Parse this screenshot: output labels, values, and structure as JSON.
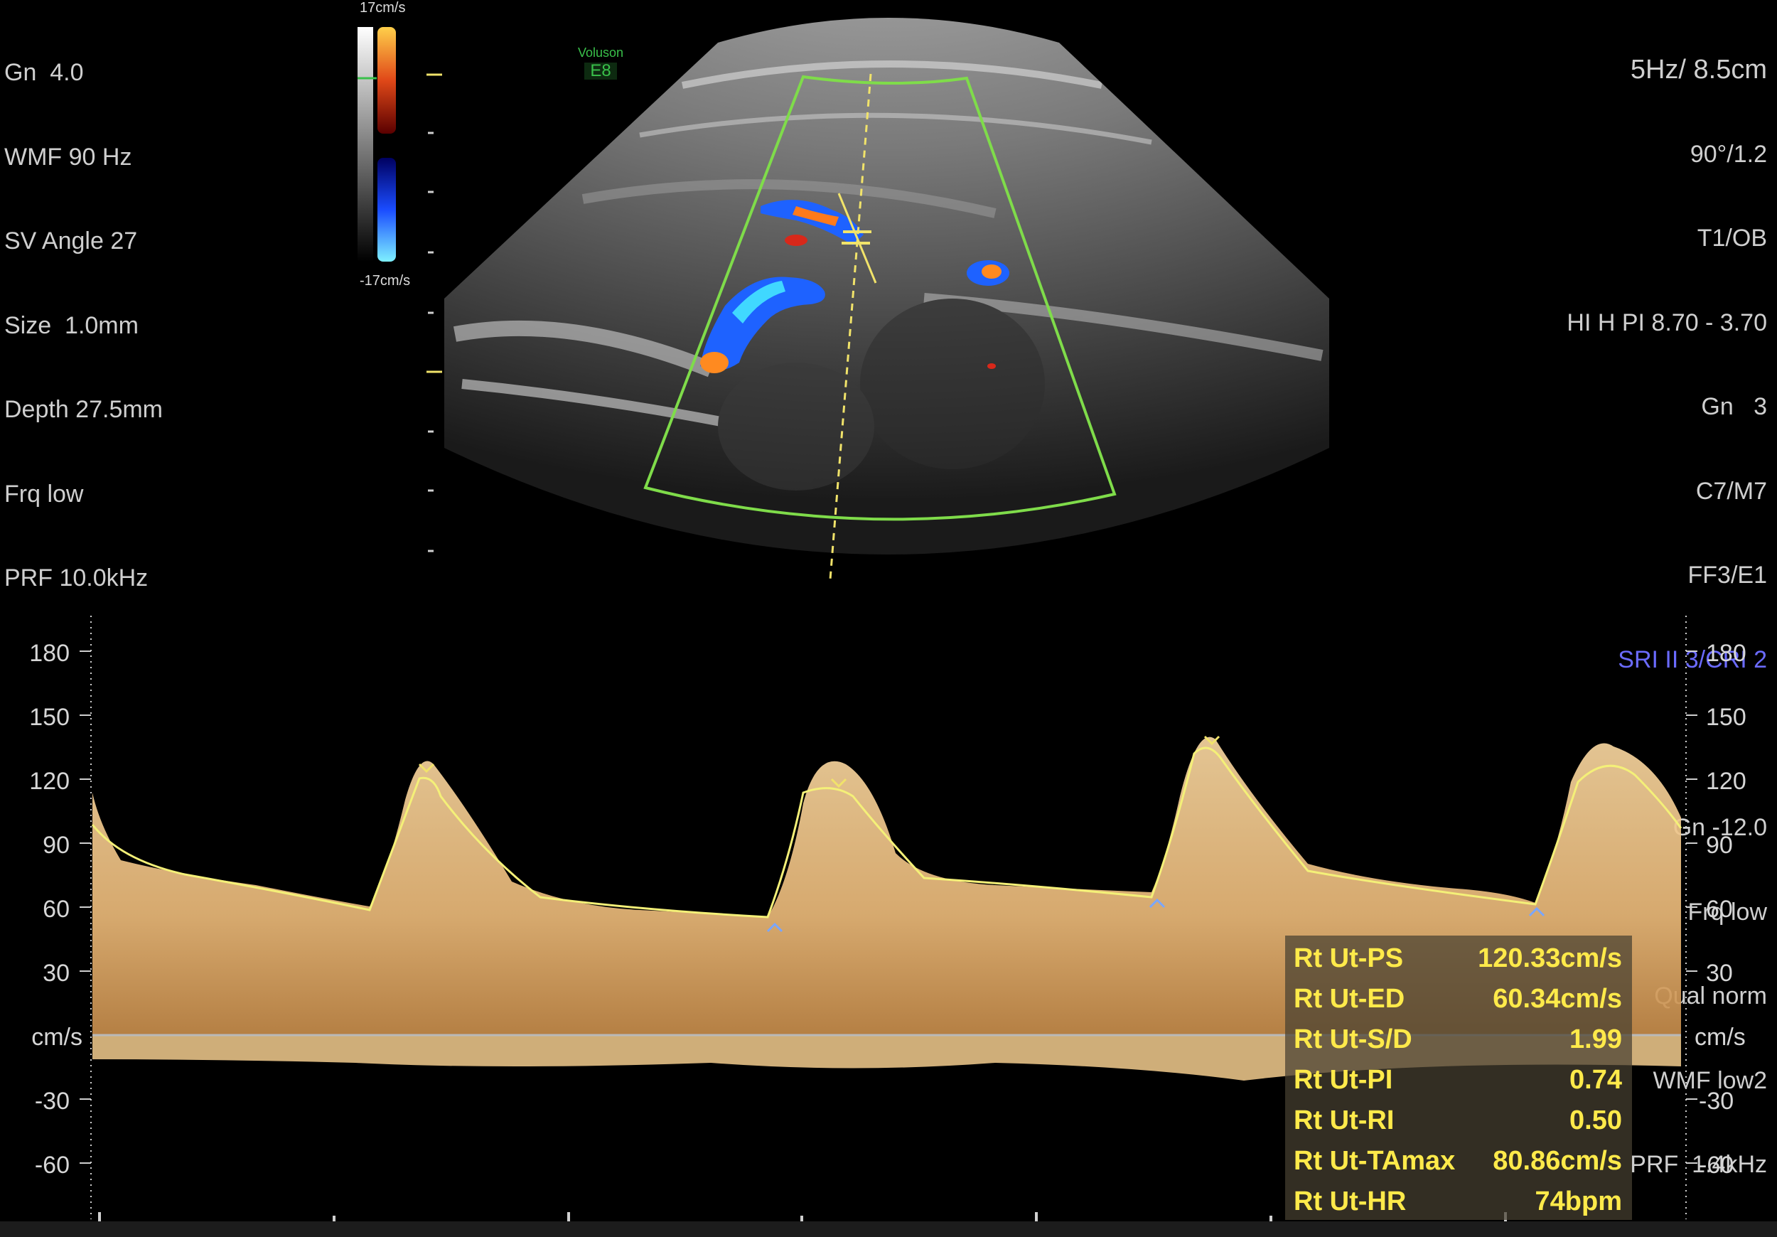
{
  "left_params": [
    "Gn  4.0",
    "WMF 90 Hz",
    "SV Angle 27",
    "Size  1.0mm",
    "Depth 27.5mm",
    "Frq low",
    "PRF 10.0kHz"
  ],
  "right_params": {
    "header": "5Hz/ 8.5cm",
    "lines": [
      "90°/1.2",
      "T1/OB",
      "HI H PI 8.70 - 3.70",
      "Gn   3",
      "C7/M7",
      "FF3/E1"
    ],
    "sri": "SRI II 3/CRI 2",
    "lines2": [
      "Gn -12.0",
      "Frq low",
      "Qual norm",
      "WMF low2",
      "PRF  1.4kHz"
    ]
  },
  "color_scale": {
    "top": "17cm/s",
    "bottom": "-17cm/s"
  },
  "logo": {
    "brand": "Voluson",
    "model": "E8"
  },
  "spectral_axis": {
    "unit": "cm/s",
    "ticks": [
      180,
      150,
      120,
      90,
      60,
      30,
      -30,
      -60
    ]
  },
  "measurements": [
    {
      "label": "Rt Ut-PS",
      "value": "120.33cm/s"
    },
    {
      "label": "Rt Ut-ED",
      "value": "60.34cm/s"
    },
    {
      "label": "Rt Ut-S/D",
      "value": "1.99"
    },
    {
      "label": "Rt Ut-PI",
      "value": "0.74"
    },
    {
      "label": "Rt Ut-RI",
      "value": "0.50"
    },
    {
      "label": "Rt Ut-TAmax",
      "value": "80.86cm/s"
    },
    {
      "label": "Rt Ut-HR",
      "value": "74bpm"
    }
  ],
  "colors": {
    "text": "#cfcfcf",
    "measurement": "#ffea4a",
    "roi_box": "#7fdc4a",
    "cursor": "#f1e36a",
    "spectrum": "#f3cc8e",
    "sri": "#6b6bff"
  }
}
